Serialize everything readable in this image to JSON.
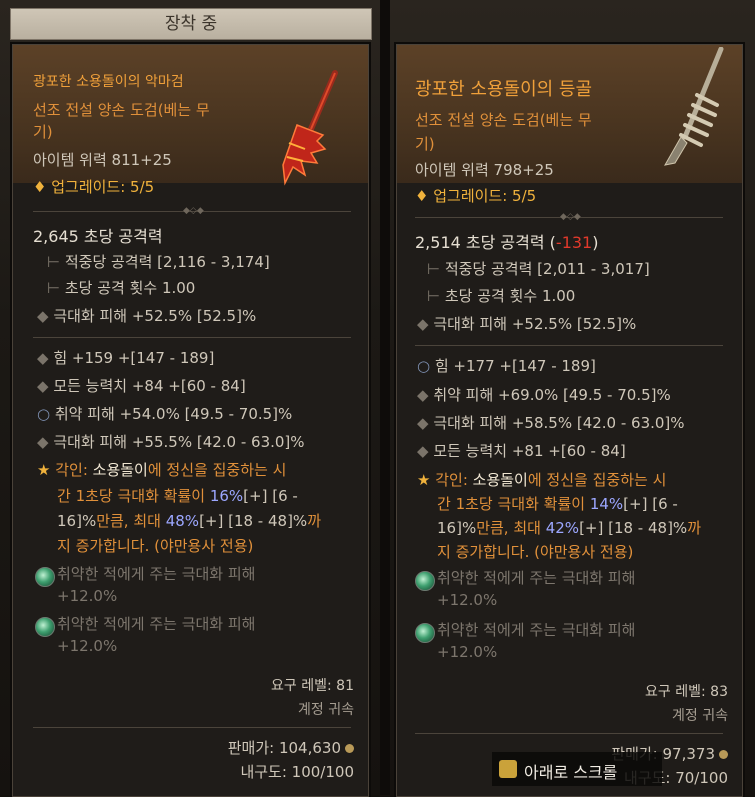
{
  "equipped_label": "장착 중",
  "left": {
    "name": "광포한 소용돌이의 악마검",
    "type_line1": "선조 전설 양손 도검(베는 무",
    "type_line2": "기)",
    "item_power": "아이템 위력 811+25",
    "upgrade": "업그레이드: 5/5",
    "dps": "2,645 초당 공격력",
    "damage_per_hit": "적중당 공격력 [2,116 - 3,174]",
    "attacks_per_second": "초당 공격 횟수 1.00",
    "crit_damage_implicit": "극대화 피해 +52.5% [52.5]%",
    "affixes": [
      "힘 +159 +[147 - 189]",
      "모든 능력치 +84 +[60 - 84]",
      "취약 피해 +54.0% [49.5 - 70.5]%",
      "극대화 피해 +55.5% [42.0 - 63.0]%"
    ],
    "aspect": {
      "l1a": "각인: ",
      "l1b": "소용돌이",
      "l1c": "에 정신을 집중하는 시",
      "l2a": "간 1초당 극대화 확률이 ",
      "l2b": "16%",
      "l2c": "[+] [6 -",
      "l3a": "16]%",
      "l3b": "만큼, 최대 ",
      "l3c": "48%",
      "l3d": "[+] [18 - 48]%",
      "l3e": "까",
      "l4": "지 증가합니다. (야만용사 전용)"
    },
    "sockets": [
      {
        "line1": "취약한 적에게 주는 극대화 피해",
        "line2": "+12.0%"
      },
      {
        "line1": "취약한 적에게 주는 극대화 피해",
        "line2": "+12.0%"
      }
    ],
    "req_level": "요구 레벨: 81",
    "account_bound": "계정 귀속",
    "sell_value": "판매가: 104,630",
    "durability": "내구도: 100/100"
  },
  "right": {
    "name": "광포한 소용돌이의 등골",
    "type_line1": "선조 전설 양손 도검(베는 무",
    "type_line2": "기)",
    "item_power": "아이템 위력 798+25",
    "upgrade": "업그레이드: 5/5",
    "dps": "2,514 초당 공격력",
    "dps_diff_open": "(",
    "dps_diff": "-131",
    "dps_diff_close": ")",
    "damage_per_hit": "적중당 공격력 [2,011 - 3,017]",
    "attacks_per_second": "초당 공격 횟수 1.00",
    "crit_damage_implicit": "극대화 피해 +52.5% [52.5]%",
    "affixes": [
      "힘 +177 +[147 - 189]",
      "취약 피해 +69.0% [49.5 - 70.5]%",
      "극대화 피해 +58.5% [42.0 - 63.0]%",
      "모든 능력치 +81 +[60 - 84]"
    ],
    "aspect": {
      "l1a": "각인: ",
      "l1b": "소용돌이",
      "l1c": "에 정신을 집중하는 시",
      "l2a": "간 1초당 극대화 확률이 ",
      "l2b": "14%",
      "l2c": "[+] [6 -",
      "l3a": "16]%",
      "l3b": "만큼, 최대 ",
      "l3c": "42%",
      "l3d": "[+] [18 - 48]%",
      "l3e": "까",
      "l4": "지 증가합니다. (야만용사 전용)"
    },
    "sockets": [
      {
        "line1": "취약한 적에게 주는 극대화 피해",
        "line2": "+12.0%"
      },
      {
        "line1": "취약한 적에게 주는 극대화 피해",
        "line2": "+12.0%"
      }
    ],
    "req_level": "요구 레벨: 83",
    "account_bound": "계정 귀속",
    "sell_value": "판매가: 97,373",
    "durability": "내구도: 70/100"
  },
  "scroll_hint": "아래로 스크롤",
  "icons": {
    "upgrade": "diamond-icon",
    "aspect": "star-icon",
    "gem": "gem-socket-icon",
    "key": "key-icon",
    "coin": "coin-icon"
  },
  "colors": {
    "legendary": "#f0a03a",
    "negative": "#e0392b",
    "highlight": "#9ca7ff"
  }
}
